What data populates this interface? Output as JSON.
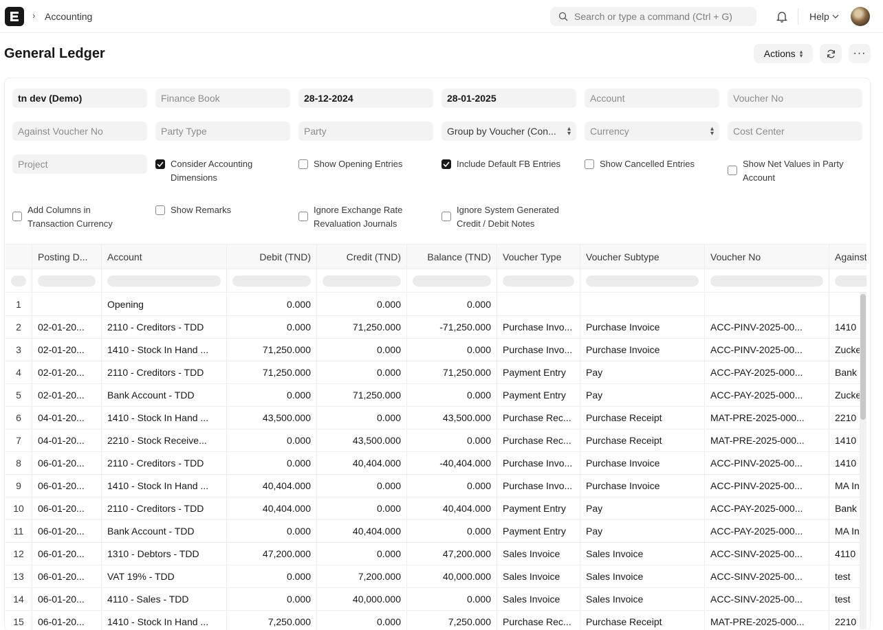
{
  "navbar": {
    "breadcrumb": "Accounting",
    "search_placeholder": "Search or type a command (Ctrl + G)",
    "help_label": "Help"
  },
  "page": {
    "title": "General Ledger",
    "actions_label": "Actions"
  },
  "filters": {
    "company": "tn dev (Demo)",
    "finance_book_placeholder": "Finance Book",
    "from_date": "28-12-2024",
    "to_date": "28-01-2025",
    "account_placeholder": "Account",
    "voucher_no_placeholder": "Voucher No",
    "against_voucher_placeholder": "Against Voucher No",
    "party_type_placeholder": "Party Type",
    "party_placeholder": "Party",
    "group_by": "Group by Voucher (Con...",
    "currency_placeholder": "Currency",
    "cost_center_placeholder": "Cost Center",
    "project_placeholder": "Project"
  },
  "checkboxes": [
    {
      "label_1": "Consider Accounting",
      "label_2": "Dimensions",
      "checked": true
    },
    {
      "label_1": "Show Opening Entries",
      "label_2": "",
      "checked": false
    },
    {
      "label_1": "Include Default FB Entries",
      "label_2": "",
      "checked": true
    },
    {
      "label_1": "Show Cancelled Entries",
      "label_2": "",
      "checked": false
    },
    {
      "label_1": "Show Net Values in Party",
      "label_2": "Account",
      "checked": false
    },
    {
      "label_1": "Add Columns in",
      "label_2": "Transaction Currency",
      "checked": false
    },
    {
      "label_1": "Show Remarks",
      "label_2": "",
      "checked": false
    },
    {
      "label_1": "Ignore Exchange Rate",
      "label_2": "Revaluation Journals",
      "checked": false
    },
    {
      "label_1": "Ignore System Generated",
      "label_2": "Credit / Debit Notes",
      "checked": false
    }
  ],
  "table": {
    "columns": [
      "Posting D...",
      "Account",
      "Debit (TND)",
      "Credit (TND)",
      "Balance (TND)",
      "Voucher Type",
      "Voucher Subtype",
      "Voucher No",
      "Against"
    ],
    "rows": [
      {
        "idx": "1",
        "date": "",
        "account": "Opening",
        "debit": "0.000",
        "credit": "0.000",
        "balance": "0.000",
        "vtype": "",
        "vsub": "",
        "vno": "",
        "against": ""
      },
      {
        "idx": "2",
        "date": "02-01-20...",
        "account": "2110 - Creditors - TDD",
        "debit": "0.000",
        "credit": "71,250.000",
        "balance": "-71,250.000",
        "vtype": "Purchase Invo...",
        "vsub": "Purchase Invoice",
        "vno": "ACC-PINV-2025-00...",
        "against": "1410"
      },
      {
        "idx": "3",
        "date": "02-01-20...",
        "account": "1410 - Stock In Hand ...",
        "debit": "71,250.000",
        "credit": "0.000",
        "balance": "0.000",
        "vtype": "Purchase Invo...",
        "vsub": "Purchase Invoice",
        "vno": "ACC-PINV-2025-00...",
        "against": "Zucke"
      },
      {
        "idx": "4",
        "date": "02-01-20...",
        "account": "2110 - Creditors - TDD",
        "debit": "71,250.000",
        "credit": "0.000",
        "balance": "71,250.000",
        "vtype": "Payment Entry",
        "vsub": "Pay",
        "vno": "ACC-PAY-2025-000...",
        "against": "Bank"
      },
      {
        "idx": "5",
        "date": "02-01-20...",
        "account": "Bank Account - TDD",
        "debit": "0.000",
        "credit": "71,250.000",
        "balance": "0.000",
        "vtype": "Payment Entry",
        "vsub": "Pay",
        "vno": "ACC-PAY-2025-000...",
        "against": "Zucke"
      },
      {
        "idx": "6",
        "date": "04-01-20...",
        "account": "1410 - Stock In Hand ...",
        "debit": "43,500.000",
        "credit": "0.000",
        "balance": "43,500.000",
        "vtype": "Purchase Rec...",
        "vsub": "Purchase Receipt",
        "vno": "MAT-PRE-2025-000...",
        "against": "2210"
      },
      {
        "idx": "7",
        "date": "04-01-20...",
        "account": "2210 - Stock Receive...",
        "debit": "0.000",
        "credit": "43,500.000",
        "balance": "0.000",
        "vtype": "Purchase Rec...",
        "vsub": "Purchase Receipt",
        "vno": "MAT-PRE-2025-000...",
        "against": "1410"
      },
      {
        "idx": "8",
        "date": "06-01-20...",
        "account": "2110 - Creditors - TDD",
        "debit": "0.000",
        "credit": "40,404.000",
        "balance": "-40,404.000",
        "vtype": "Purchase Invo...",
        "vsub": "Purchase Invoice",
        "vno": "ACC-PINV-2025-00...",
        "against": "1410"
      },
      {
        "idx": "9",
        "date": "06-01-20...",
        "account": "1410 - Stock In Hand ...",
        "debit": "40,404.000",
        "credit": "0.000",
        "balance": "0.000",
        "vtype": "Purchase Invo...",
        "vsub": "Purchase Invoice",
        "vno": "ACC-PINV-2025-00...",
        "against": "MA In"
      },
      {
        "idx": "10",
        "date": "06-01-20...",
        "account": "2110 - Creditors - TDD",
        "debit": "40,404.000",
        "credit": "0.000",
        "balance": "40,404.000",
        "vtype": "Payment Entry",
        "vsub": "Pay",
        "vno": "ACC-PAY-2025-000...",
        "against": "Bank"
      },
      {
        "idx": "11",
        "date": "06-01-20...",
        "account": "Bank Account - TDD",
        "debit": "0.000",
        "credit": "40,404.000",
        "balance": "0.000",
        "vtype": "Payment Entry",
        "vsub": "Pay",
        "vno": "ACC-PAY-2025-000...",
        "against": "MA In"
      },
      {
        "idx": "12",
        "date": "06-01-20...",
        "account": "1310 - Debtors - TDD",
        "debit": "47,200.000",
        "credit": "0.000",
        "balance": "47,200.000",
        "vtype": "Sales Invoice",
        "vsub": "Sales Invoice",
        "vno": "ACC-SINV-2025-00...",
        "against": "4110"
      },
      {
        "idx": "13",
        "date": "06-01-20...",
        "account": "VAT 19% - TDD",
        "debit": "0.000",
        "credit": "7,200.000",
        "balance": "40,000.000",
        "vtype": "Sales Invoice",
        "vsub": "Sales Invoice",
        "vno": "ACC-SINV-2025-00...",
        "against": "test"
      },
      {
        "idx": "14",
        "date": "06-01-20...",
        "account": "4110 - Sales - TDD",
        "debit": "0.000",
        "credit": "40,000.000",
        "balance": "0.000",
        "vtype": "Sales Invoice",
        "vsub": "Sales Invoice",
        "vno": "ACC-SINV-2025-00...",
        "against": "test"
      },
      {
        "idx": "15",
        "date": "06-01-20...",
        "account": "1410 - Stock In Hand ...",
        "debit": "7,250.000",
        "credit": "0.000",
        "balance": "7,250.000",
        "vtype": "Purchase Rec...",
        "vsub": "Purchase Receipt",
        "vno": "MAT-PRE-2025-000...",
        "against": "2210"
      }
    ]
  }
}
